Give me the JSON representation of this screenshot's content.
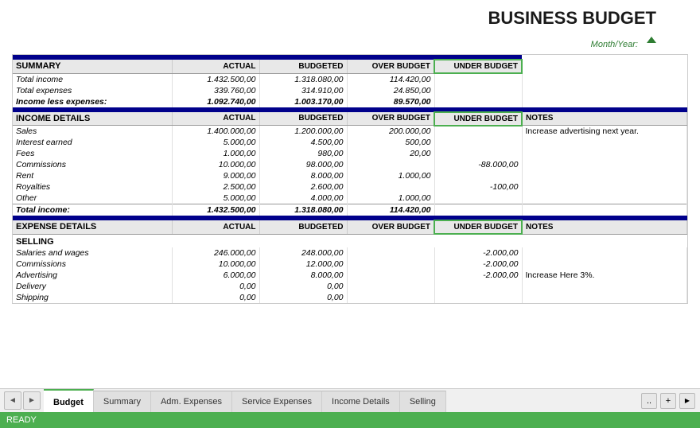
{
  "title": "BUSINESS BUDGET",
  "month_year_label": "Month/Year:",
  "summary_section": {
    "header": "SUMMARY",
    "columns": [
      "ACTUAL",
      "BUDGETED",
      "OVER BUDGET",
      "UNDER BUDGET"
    ],
    "rows": [
      {
        "label": "Total income",
        "actual": "1.432.500,00",
        "budgeted": "1.318.080,00",
        "over": "114.420,00",
        "under": ""
      },
      {
        "label": "Total expenses",
        "actual": "339.760,00",
        "budgeted": "314.910,00",
        "over": "24.850,00",
        "under": ""
      },
      {
        "label": "Income less expenses:",
        "actual": "1.092.740,00",
        "budgeted": "1.003.170,00",
        "over": "89.570,00",
        "under": ""
      }
    ]
  },
  "income_section": {
    "header": "INCOME DETAILS",
    "columns": [
      "ACTUAL",
      "BUDGETED",
      "OVER BUDGET",
      "UNDER BUDGET",
      "NOTES"
    ],
    "rows": [
      {
        "label": "Sales",
        "actual": "1.400.000,00",
        "budgeted": "1.200.000,00",
        "over": "200.000,00",
        "under": "",
        "notes": "Increase advertising next year."
      },
      {
        "label": "Interest earned",
        "actual": "5.000,00",
        "budgeted": "4.500,00",
        "over": "500,00",
        "under": "",
        "notes": ""
      },
      {
        "label": "Fees",
        "actual": "1.000,00",
        "budgeted": "980,00",
        "over": "20,00",
        "under": "",
        "notes": ""
      },
      {
        "label": "Commissions",
        "actual": "10.000,00",
        "budgeted": "98.000,00",
        "over": "",
        "under": "-88.000,00",
        "notes": ""
      },
      {
        "label": "Rent",
        "actual": "9.000,00",
        "budgeted": "8.000,00",
        "over": "1.000,00",
        "under": "",
        "notes": ""
      },
      {
        "label": "Royalties",
        "actual": "2.500,00",
        "budgeted": "2.600,00",
        "over": "",
        "under": "-100,00",
        "notes": ""
      },
      {
        "label": "Other",
        "actual": "5.000,00",
        "budgeted": "4.000,00",
        "over": "1.000,00",
        "under": "",
        "notes": ""
      },
      {
        "label": "Total income:",
        "actual": "1.432.500,00",
        "budgeted": "1.318.080,00",
        "over": "114.420,00",
        "under": "",
        "notes": ""
      }
    ]
  },
  "expense_section": {
    "header": "EXPENSE DETAILS",
    "columns": [
      "ACTUAL",
      "BUDGETED",
      "OVER BUDGET",
      "UNDER BUDGET",
      "NOTES"
    ],
    "selling_header": "SELLING",
    "rows": [
      {
        "label": "Salaries and wages",
        "actual": "246.000,00",
        "budgeted": "248.000,00",
        "over": "",
        "under": "-2.000,00",
        "notes": ""
      },
      {
        "label": "Commissions",
        "actual": "10.000,00",
        "budgeted": "12.000,00",
        "over": "",
        "under": "-2.000,00",
        "notes": ""
      },
      {
        "label": "Advertising",
        "actual": "6.000,00",
        "budgeted": "8.000,00",
        "over": "",
        "under": "-2.000,00",
        "notes": "Increase Here 3%."
      },
      {
        "label": "Delivery",
        "actual": "0,00",
        "budgeted": "0,00",
        "over": "",
        "under": "",
        "notes": ""
      },
      {
        "label": "Shipping",
        "actual": "0,00",
        "budgeted": "0,00",
        "over": "",
        "under": "",
        "notes": ""
      }
    ]
  },
  "tabs": [
    {
      "label": "Budget",
      "active": true
    },
    {
      "label": "Summary",
      "active": false
    },
    {
      "label": "Adm. Expenses",
      "active": false
    },
    {
      "label": "Service Expenses",
      "active": false
    },
    {
      "label": "Income Details",
      "active": false
    },
    {
      "label": "Selling",
      "active": false
    }
  ],
  "status": "READY",
  "nav_buttons": {
    "prev": "◄",
    "next": "►",
    "dots": "..",
    "add": "+",
    "scroll_right": "►"
  }
}
